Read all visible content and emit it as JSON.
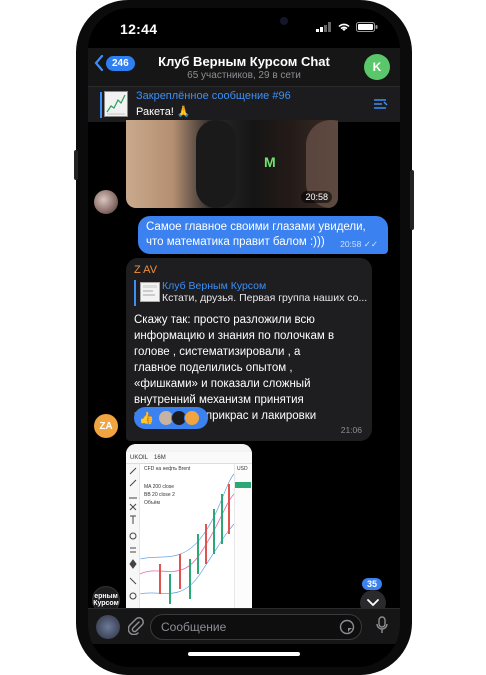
{
  "status": {
    "time": "12:44"
  },
  "header": {
    "back_count": "246",
    "title": "Клуб Верным Курсом Chat",
    "subtitle": "65 участников, 29 в сети",
    "avatar_letter": "K"
  },
  "pinned": {
    "title": "Закреплённое сообщение #96",
    "text": "Ракета! 🙏"
  },
  "messages": {
    "video_duration": "20:58",
    "out": {
      "line1": "Самое главное своими глазами увидели,",
      "line2": "что математика правит балом :)))",
      "time": "20:58"
    },
    "in": {
      "sender": "Z AV",
      "fwd_title": "Клуб Верным Курсом",
      "fwd_text": "Кстати, друзья. Первая группа наших со...",
      "lines": [
        "Скажу так: просто разложили всю",
        "информацию и знания по полочкам в",
        "голове , систематизировали , а",
        "главное поделились опытом ,",
        "«фишками» и показали сложный",
        "внутренний механизм принятия",
        "решений без прикрас и лакировки"
      ],
      "reaction": "👍",
      "time": "21:06",
      "avatar_initials": "ZA"
    },
    "screenshot": {
      "ticker": "UKOIL",
      "interval": "16M",
      "cfd_label": "CFD на нефть Brent",
      "ma_label": "MA 200 close",
      "bb_label": "BB 20 close 2",
      "vol_label": "Объём",
      "currency": "USD"
    },
    "group_avatar_text": "ерным Курсом"
  },
  "scroll": {
    "unread_count": "35"
  },
  "composer": {
    "placeholder": "Сообщение"
  },
  "colors": {
    "accent": "#3b82f0",
    "bubble_in": "#1e1e20",
    "sender": "#f08f3c",
    "bg": "#000000"
  }
}
